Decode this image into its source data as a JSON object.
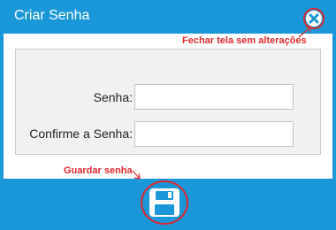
{
  "dialog": {
    "title": "Criar Senha"
  },
  "icons": {
    "close": "close-icon",
    "save": "floppy-disk-icon"
  },
  "form": {
    "password_label": "Senha:",
    "password_value": "",
    "confirm_label": "Confirme a Senha:",
    "confirm_value": ""
  },
  "annotations": {
    "close_note": "Fechar tela sem alterações",
    "save_note": "Guardar senha"
  },
  "colors": {
    "header_blue": "#1a97d8",
    "annotation_red": "#e02a2f"
  }
}
